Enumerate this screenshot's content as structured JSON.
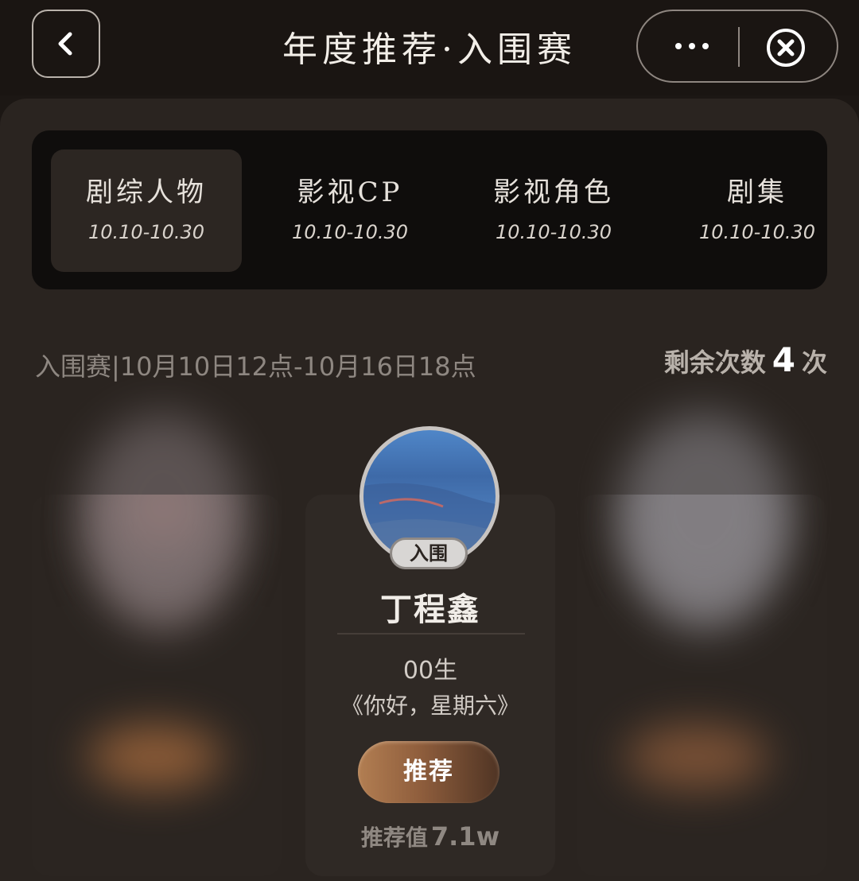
{
  "header": {
    "title": "年度推荐·入围赛",
    "more_label": "···"
  },
  "tabs": [
    {
      "title": "剧综人物",
      "date": "10.10-10.30",
      "active": true
    },
    {
      "title": "影视CP",
      "date": "10.10-10.30",
      "active": false
    },
    {
      "title": "影视角色",
      "date": "10.10-10.30",
      "active": false
    },
    {
      "title": "剧集",
      "date": "10.10-10.30",
      "active": false
    }
  ],
  "round": {
    "info": "入围赛|10月10日12点-10月16日18点",
    "remaining_prefix": "剩余次数",
    "remaining_count": "4",
    "remaining_suffix": "次"
  },
  "featured": {
    "badge": "入围",
    "name": "丁程鑫",
    "line1": "00生",
    "line2": "《你好，星期六》",
    "button": "推荐",
    "score_label": "推荐值",
    "score_value": "7.1w"
  },
  "colors": {
    "background": "#1c1714",
    "panel": "#2a2420",
    "accent_button": "#9a6a45"
  },
  "icons": {
    "back": "chevron-left-icon",
    "more": "more-dots-icon",
    "close": "close-circle-icon"
  }
}
